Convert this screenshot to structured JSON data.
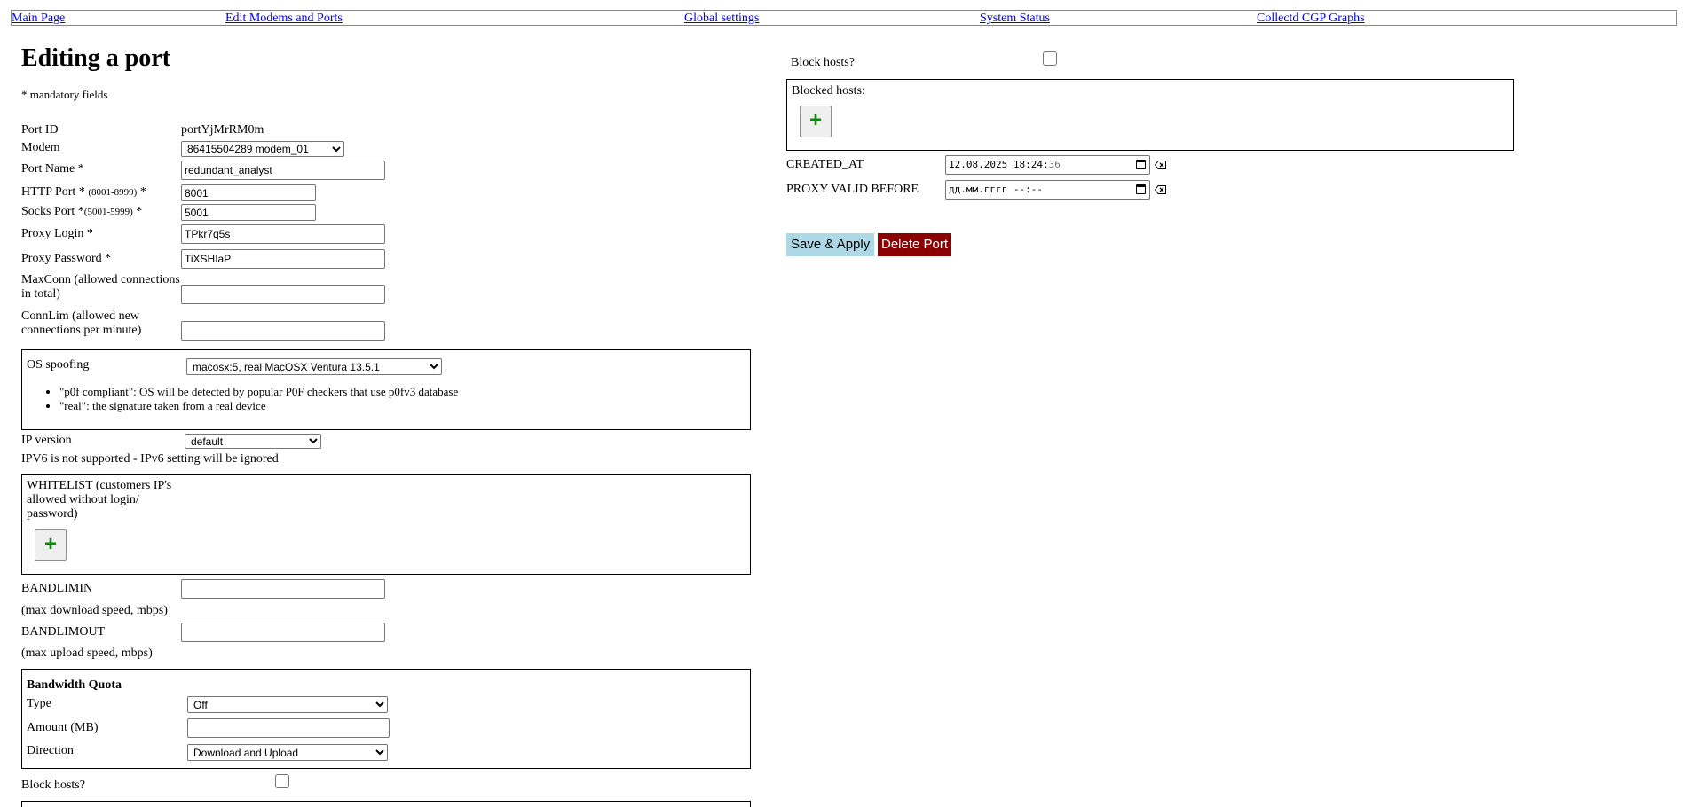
{
  "nav": {
    "main": "Main Page",
    "modems": "Edit Modems and Ports",
    "global": "Global settings",
    "status": "System Status",
    "graphs": "Collectd CGP Graphs"
  },
  "page": {
    "title": "Editing a port",
    "mandatory_note": "* mandatory fields"
  },
  "form": {
    "port_id_label": "Port ID",
    "port_id_value": "portYjMrRM0m",
    "modem_label": "Modem",
    "modem_value": "86415504289       modem_01",
    "port_name_label": "Port Name *",
    "port_name_value": "redundant_analyst",
    "http_port_label": "HTTP Port *",
    "http_port_range": "(8001-8999)",
    "http_port_star": "*",
    "http_port_value": "8001",
    "socks_port_label": "Socks Port *",
    "socks_port_range": "(5001-5999)",
    "socks_port_star": "*",
    "socks_port_value": "5001",
    "proxy_login_label": "Proxy Login *",
    "proxy_login_value": "TPkr7q5s",
    "proxy_password_label": "Proxy Password *",
    "proxy_password_value": "TiXSHIaP",
    "maxconn_label": "MaxConn (allowed connections in total)",
    "maxconn_value": "",
    "connlim_label": "ConnLim (allowed new connections per minute)",
    "connlim_value": ""
  },
  "os_spoofing": {
    "label": "OS spoofing",
    "value": "macosx:5, real MacOSX Ventura 13.5.1",
    "notes": [
      "\"p0f compliant\": OS will be detected by popular P0F checkers that use p0fv3 database",
      "\"real\": the signature taken from a real device"
    ]
  },
  "ip_version": {
    "label": "IP version",
    "value": "default",
    "warning": "IPV6 is not supported - IPv6 setting will be ignored"
  },
  "whitelist": {
    "label": "WHITELIST (customers IP's allowed without login/ password)",
    "add_symbol": "+"
  },
  "bandwidth": {
    "in_label": "BANDLIMIN",
    "in_note": "(max download speed, mbps)",
    "in_value": "",
    "out_label": "BANDLIMOUT",
    "out_note": "(max upload speed, mbps)",
    "out_value": ""
  },
  "quota": {
    "title": "Bandwidth Quota",
    "type_label": "Type",
    "type_value": "Off",
    "amount_label": "Amount (MB)",
    "amount_value": "",
    "direction_label": "Direction",
    "direction_value": "Download and Upload"
  },
  "block_left": {
    "label": "Block hosts?",
    "checked": false
  },
  "right": {
    "block_label": "Block hosts?",
    "block_checked": false,
    "blocked_hosts_label": "Blocked hosts:",
    "add_symbol": "+",
    "created_at_label": "CREATED_AT",
    "created_at_value": "12.08.2025 18:24:",
    "created_at_seconds": "36",
    "valid_before_label": "PROXY VALID BEFORE",
    "valid_before_value": "дд.мм.гггг --:--",
    "save_label": "Save & Apply",
    "delete_label": "Delete Port"
  },
  "colors": {
    "save_bg": "#add8e6",
    "delete_bg": "#8b0000",
    "plus_green": "#0a8a0a",
    "link": "#0000ee"
  }
}
